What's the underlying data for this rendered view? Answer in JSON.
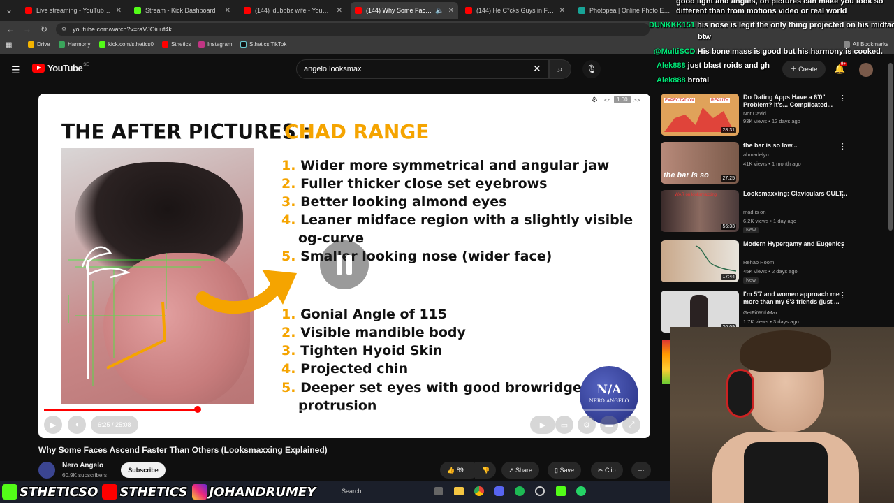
{
  "tabs": [
    {
      "label": "Live streaming - YouTube Stud",
      "color": "#ff0000"
    },
    {
      "label": "Stream - Kick Dashboard",
      "color": "#53fc18"
    },
    {
      "label": "(144) idubbbz wife - YouTube",
      "color": "#ff0000"
    },
    {
      "label": "(144) Why Some Faces Asc",
      "color": "#ff0000"
    },
    {
      "label": "(144) He C*cks Guys in Front of",
      "color": "#ff0000"
    },
    {
      "label": "Photopea | Online Photo Editor",
      "color": "#18a497"
    }
  ],
  "address": {
    "url": "youtube.com/watch?v=raVJOiuuf4k"
  },
  "bookmarks": [
    "Drive",
    "Harmony",
    "kick.com/sthetics0",
    "Sthetics",
    "Instagram",
    "Sthetics TikTok"
  ],
  "bookmarks_all": "All Bookmarks",
  "youtube": {
    "logo": "YouTube",
    "region": "SE",
    "search_value": "angelo looksmax",
    "create_label": "Create",
    "notif_count": "9+"
  },
  "video": {
    "slide_title": "THE AFTER PICTURES :",
    "slide_title_accent": "CHAD RANGE",
    "list1": [
      {
        "n": "1.",
        "t": "Wider more symmetrical and angular jaw"
      },
      {
        "n": "2.",
        "t": "Fuller thicker close set eyebrows"
      },
      {
        "n": "3.",
        "t": "Better looking almond eyes"
      },
      {
        "n": "4.",
        "t": "Leaner midface region with a slightly visible"
      },
      {
        "n": "",
        "t": "og-curve"
      },
      {
        "n": "5.",
        "t": "Smaller looking nose (wider face)"
      }
    ],
    "list2": [
      {
        "n": "1.",
        "t": "Gonial Angle of 115"
      },
      {
        "n": "2.",
        "t": "Visible mandible body"
      },
      {
        "n": "3.",
        "t": "Tighten Hyoid Skin"
      },
      {
        "n": "4.",
        "t": "Projected chin"
      },
      {
        "n": "5.",
        "t": "Deeper set eyes with good browridge"
      },
      {
        "n": "",
        "t": "protrusion"
      }
    ],
    "watermark_top": "N/A",
    "watermark_bottom": "NERO ANGELO",
    "speed": "1.00",
    "speed_prev": "<<",
    "speed_next": ">>",
    "time": "6:25 / 25:08",
    "progress": 0.256,
    "title": "Why Some Faces Ascend Faster Than Others (Looksmaxxing Explained)"
  },
  "channel": {
    "name": "Nero Angelo",
    "subs": "60.9K subscribers",
    "subscribe_label": "Subscribe"
  },
  "actions": {
    "likes": "89",
    "share": "Share",
    "save": "Save",
    "clip": "Clip"
  },
  "recommendations": [
    {
      "title": "Do Dating Apps Have a 6'0\" Problem? It's... Complicated...",
      "channel": "Not David",
      "meta": "93K views • 12 days ago",
      "duration": "28:31",
      "new": false,
      "thumb": "#e0a25a",
      "thumb_top": "EXPECTATION",
      "thumb_top2": "REALITY"
    },
    {
      "title": "the bar is so low...",
      "channel": "ahmadelyo",
      "meta": "41K views • 1 month ago",
      "duration": "27:25",
      "new": false,
      "thumb": "#9a7060",
      "thumb_caption": "the bar is so"
    },
    {
      "title": "Looksmaxxing: Claviculars CULT...",
      "channel": "mad is on",
      "meta": "6.2K views • 1 day ago",
      "duration": "56:33",
      "new": true,
      "thumb": "#6a5a5a",
      "thumb_top": "WAR on looksmaxxing"
    },
    {
      "title": "Modern Hypergamy and Eugenics",
      "channel": "Rehab Room",
      "meta": "45K views • 2 days ago",
      "duration": "17:44",
      "new": true,
      "thumb": "#7a8a7a"
    },
    {
      "title": "I'm 5'7 and women approach me more than my 6'3 friends (just ...",
      "channel": "GetFitWithMax",
      "meta": "1.7K views • 3 days ago",
      "duration": "20:09",
      "new": false,
      "thumb": "#d9d9d9"
    }
  ],
  "new_label": "New",
  "chat": [
    {
      "user": "",
      "msg": "good light and angles, on pictures can make you look so"
    },
    {
      "user": "",
      "msg": "different than from motions video or real world"
    },
    {
      "user": "DUNKKK151",
      "msg": "his nose is legit the only thing projected on his midface"
    },
    {
      "user": "",
      "msg": "btw"
    },
    {
      "user": "@MultiSCD",
      "msg": "His bone mass is good but his harmony is cooked."
    },
    {
      "user": "Alek888",
      "msg": "just blast roids and gh"
    },
    {
      "user": "Alek888",
      "msg": "brotal"
    }
  ],
  "social_bar": {
    "kick": "STHETICSO",
    "youtube": "STHETICS",
    "instagram": "JOHANDRUMEY"
  },
  "taskbar": {
    "search": "Search"
  },
  "colors": {
    "accent": "#f5a400",
    "youtube_red": "#ff0000",
    "kick_green": "#53fc18"
  }
}
